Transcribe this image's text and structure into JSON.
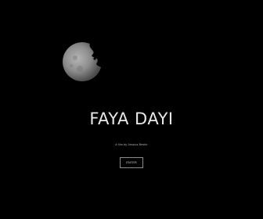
{
  "site": {
    "title": "FAYA DAYI",
    "credit": "A film by Jessica Beshir",
    "enter_label": "ENTER"
  },
  "icons": {
    "moon": "moon-icon"
  },
  "colors": {
    "background": "#000000",
    "title": "#e8e8e8",
    "button_border": "#8a8a8a"
  }
}
